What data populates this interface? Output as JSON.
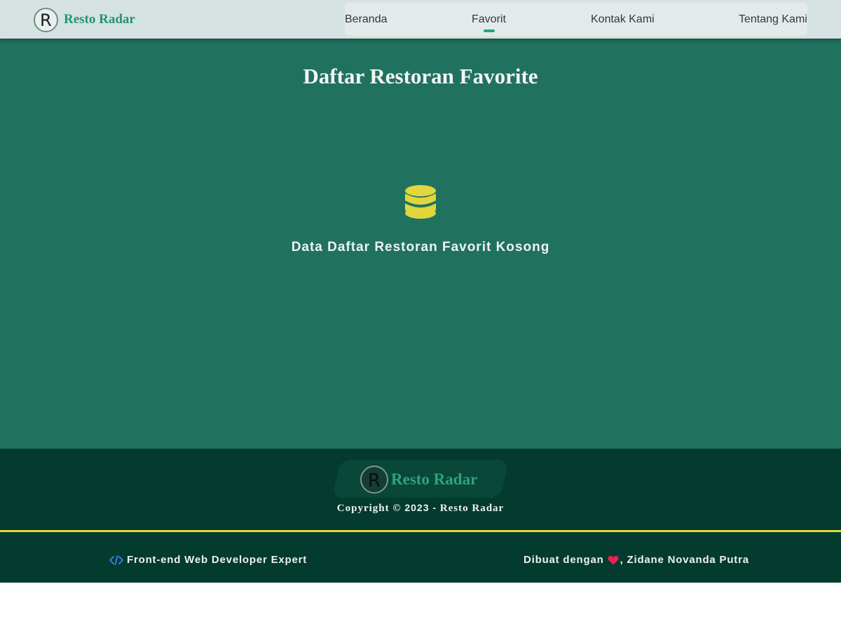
{
  "header": {
    "brand_name": "Resto Radar",
    "logo_letter": "R",
    "nav": [
      {
        "label": "Beranda"
      },
      {
        "label": "Favorit",
        "active": true
      },
      {
        "label": "Kontak Kami"
      },
      {
        "label": "Tentang Kami"
      }
    ]
  },
  "main": {
    "title": "Daftar Restoran Favorite",
    "empty_icon": "database-icon",
    "empty_text": "Data Daftar Restoran Favorit Kosong"
  },
  "footer": {
    "brand_name": "Resto Radar",
    "logo_letter": "R",
    "copyright_prefix": "Copyright ©",
    "copyright_year": "2023 -",
    "copyright_brand": "Resto Radar",
    "left_icon": "code-icon",
    "left_text": "Front-end Web Developer Expert",
    "right_prefix": "Dibuat dengan",
    "right_icon": "heart-icon",
    "right_suffix": ", Zidane Novanda Putra"
  },
  "colors": {
    "header_bg": "#d6e2e1",
    "brand_green": "#23946f",
    "main_bg": "#20725f",
    "footer_bg": "#033b2e",
    "accent_yellow": "#e2d63d",
    "icon_yellow": "#e1d63c",
    "heart_red": "#e8224d",
    "code_blue": "#2f7de1"
  }
}
